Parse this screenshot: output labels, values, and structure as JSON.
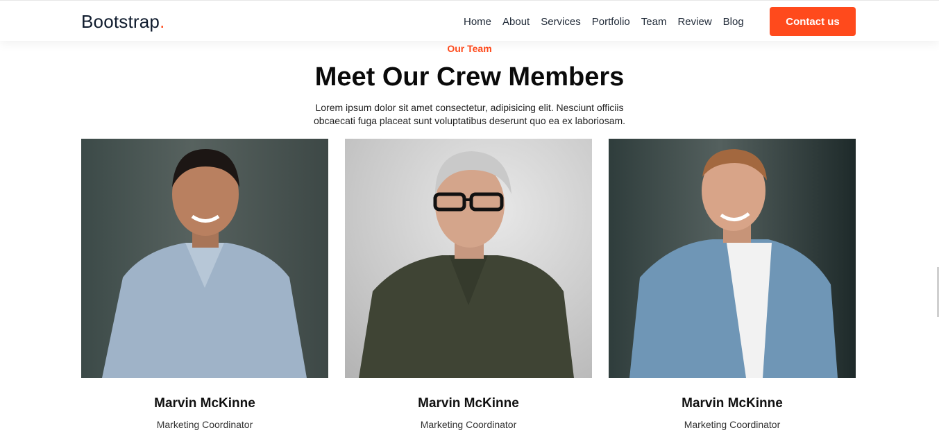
{
  "navbar": {
    "brand": "Bootstrap",
    "brand_dot": ".",
    "links": [
      "Home",
      "About",
      "Services",
      "Portfolio",
      "Team",
      "Review",
      "Blog"
    ],
    "cta_label": "Contact us"
  },
  "section": {
    "eyebrow": "Our Team",
    "title": "Meet Our Crew Members",
    "subtitle": "Lorem ipsum dolor sit amet consectetur, adipisicing elit. Nesciunt officiis obcaecati fuga placeat sunt voluptatibus deserunt quo ea ex laboriosam."
  },
  "members": [
    {
      "name": "Marvin McKinne",
      "role": "Marketing Coordinator"
    },
    {
      "name": "Marvin McKinne",
      "role": "Marketing Coordinator"
    },
    {
      "name": "Marvin McKinne",
      "role": "Marketing Coordinator"
    }
  ],
  "colors": {
    "accent": "#ff4a1c",
    "brand_text": "#0f1b2d"
  }
}
